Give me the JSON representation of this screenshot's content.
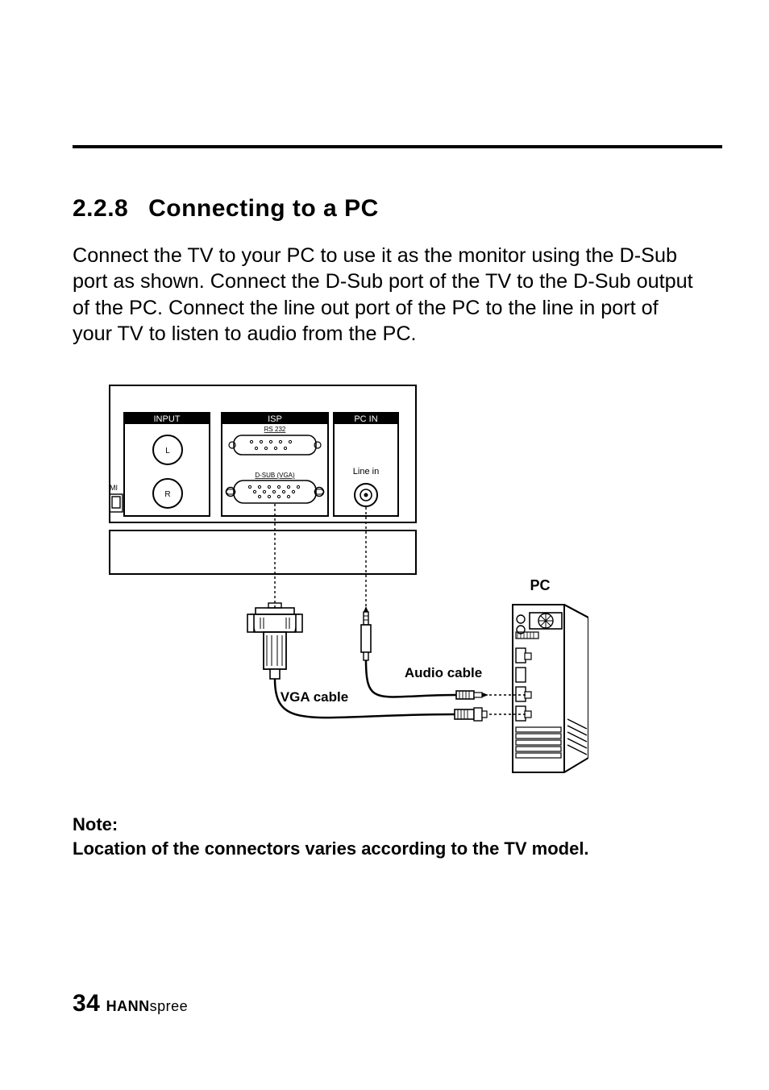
{
  "heading": {
    "number": "2.2.8",
    "title": "Connecting to a PC"
  },
  "paragraph": "Connect the TV to your PC to use it as the monitor using the D-Sub port as shown. Connect the D-Sub port of the TV to the D-Sub output of the PC. Connect the line out port of the PC to the line in port of your TV to listen to audio from the PC.",
  "note": {
    "lead": "Note:",
    "text": "Location of the connectors varies according to the TV model."
  },
  "footer": {
    "page_number": "34",
    "brand_bold": "HANN",
    "brand_light": "spree"
  },
  "diagram": {
    "panel_labels": {
      "input": "INPUT",
      "isp": "ISP",
      "pcin": "PC IN",
      "rs232": "RS 232",
      "dsub": "D-SUB (VGA)",
      "line_in": "Line in",
      "l": "L",
      "r": "R",
      "hdmi_side": "MI"
    },
    "callouts": {
      "audio_cable": "Audio cable",
      "vga_cable": "VGA cable",
      "pc": "PC"
    }
  }
}
